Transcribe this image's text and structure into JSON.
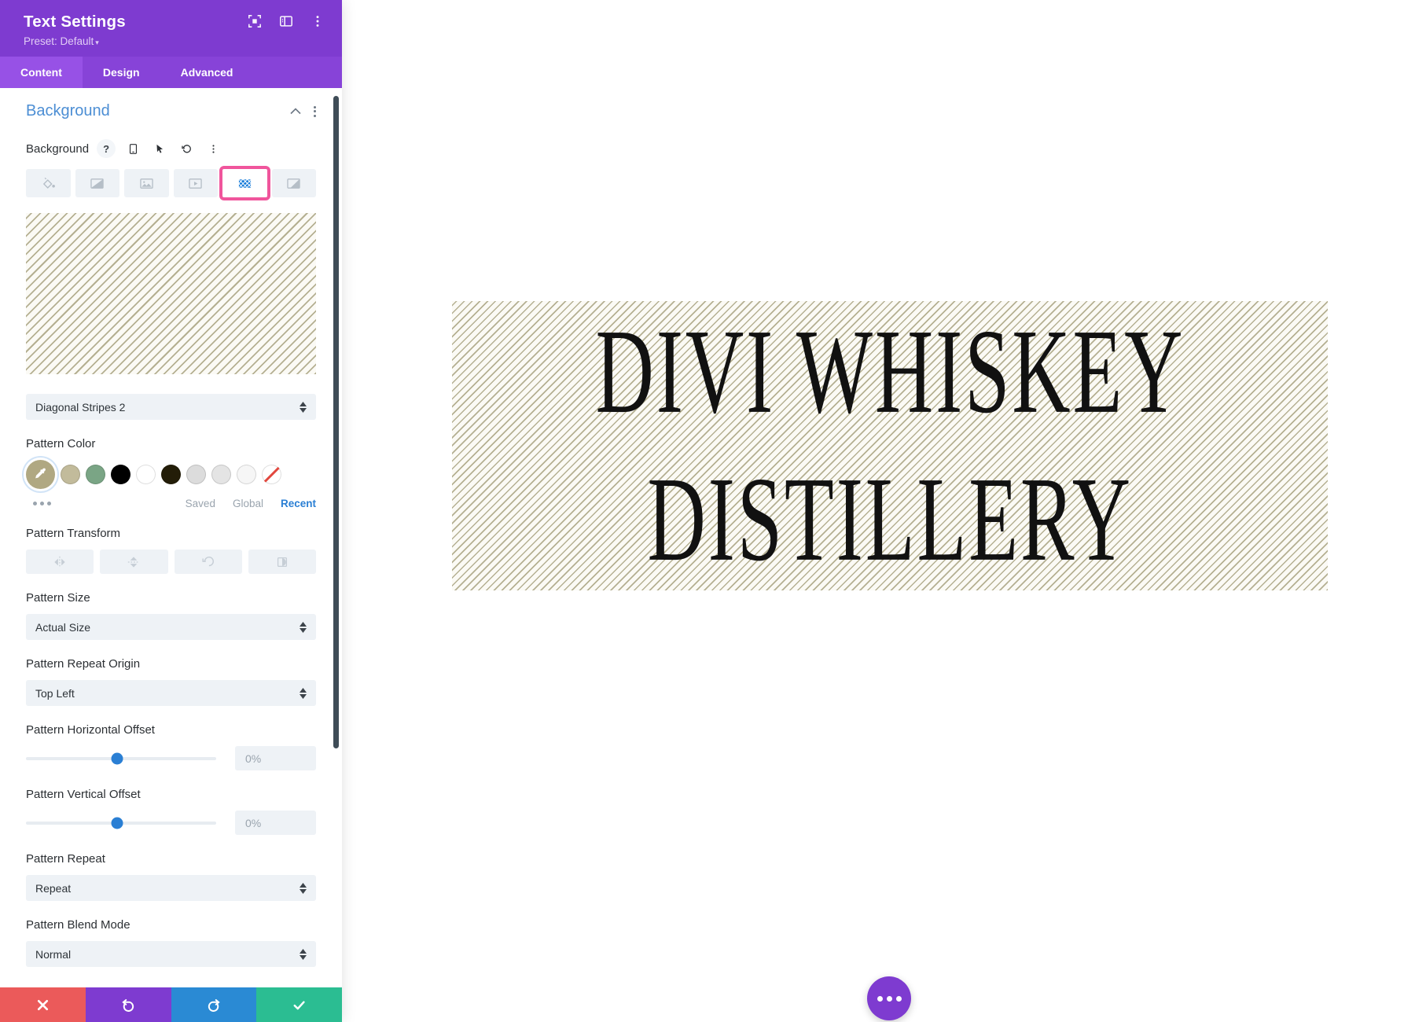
{
  "panel": {
    "title": "Text Settings",
    "preset": "Preset: Default",
    "preset_caret": "▾",
    "header_icons": [
      {
        "name": "focus-frame-icon"
      },
      {
        "name": "layout-panel-icon"
      },
      {
        "name": "kebab-menu-icon"
      }
    ],
    "tabs": [
      {
        "label": "Content",
        "active": true
      },
      {
        "label": "Design",
        "active": false
      },
      {
        "label": "Advanced",
        "active": false
      }
    ],
    "section": {
      "title": "Background",
      "collapse_icon": "chevron-up-icon",
      "more_icon": "kebab-menu-icon"
    },
    "background_field": {
      "label": "Background",
      "tools": [
        "help-icon",
        "responsive-phone-icon",
        "hover-cursor-icon",
        "reset-undo-icon",
        "kebab-menu-icon"
      ]
    },
    "background_types": [
      {
        "name": "color-fill",
        "selected": false
      },
      {
        "name": "gradient",
        "selected": false
      },
      {
        "name": "image",
        "selected": false
      },
      {
        "name": "video",
        "selected": false
      },
      {
        "name": "pattern",
        "selected": true
      },
      {
        "name": "mask",
        "selected": false
      }
    ],
    "pattern": {
      "style_value": "Diagonal Stripes 2",
      "preview_color": "#b5b092",
      "preview_bg": "#fbfaf5",
      "color_label": "Pattern Color",
      "swatches": [
        {
          "name": "eyedropper-active",
          "color": "#b0a882",
          "type": "eyedropper"
        },
        {
          "name": "swatch-khaki",
          "color": "#c2bb9b",
          "type": "solid"
        },
        {
          "name": "swatch-sage-green",
          "color": "#7aa585",
          "type": "solid"
        },
        {
          "name": "swatch-black",
          "color": "#000000",
          "type": "solid"
        },
        {
          "name": "swatch-white",
          "color": "#ffffff",
          "type": "solid"
        },
        {
          "name": "swatch-dark-olive",
          "color": "#231d08",
          "type": "solid"
        },
        {
          "name": "swatch-light-gray-1",
          "color": "#dcdcdc",
          "type": "solid"
        },
        {
          "name": "swatch-light-gray-2",
          "color": "#e4e4e4",
          "type": "solid"
        },
        {
          "name": "swatch-off-white",
          "color": "#f6f6f6",
          "type": "solid"
        },
        {
          "name": "swatch-no-color",
          "color": "#ffffff",
          "type": "none"
        }
      ],
      "meta_links": [
        {
          "label": "Saved",
          "active": false
        },
        {
          "label": "Global",
          "active": false
        },
        {
          "label": "Recent",
          "active": true
        }
      ],
      "transform_label": "Pattern Transform",
      "transform_buttons": [
        "flip-horizontal-icon",
        "flip-vertical-icon",
        "rotate-icon",
        "invert-icon"
      ],
      "size_label": "Pattern Size",
      "size_value": "Actual Size",
      "repeat_origin_label": "Pattern Repeat Origin",
      "repeat_origin_value": "Top Left",
      "horizontal_offset_label": "Pattern Horizontal Offset",
      "horizontal_offset_value": "0%",
      "vertical_offset_label": "Pattern Vertical Offset",
      "vertical_offset_value": "0%",
      "repeat_label": "Pattern Repeat",
      "repeat_value": "Repeat",
      "blend_mode_label": "Pattern Blend Mode",
      "blend_mode_value": "Normal"
    },
    "footer": [
      {
        "name": "cancel-button",
        "icon": "close-icon",
        "color": "#eb5a5a"
      },
      {
        "name": "undo-button",
        "icon": "undo-icon",
        "color": "#7e3bd0"
      },
      {
        "name": "redo-button",
        "icon": "redo-icon",
        "color": "#2a8ad4"
      },
      {
        "name": "save-button",
        "icon": "check-icon",
        "color": "#2bbd92"
      }
    ],
    "accent_selected": "#f0559c",
    "accent_purple": "#7e3bd0",
    "accent_blue": "#2a7fd4"
  },
  "canvas": {
    "hero": {
      "line1": "DIVI WHISKEY",
      "line2": "DISTILLERY",
      "pattern_color": "#b5b092",
      "bg_color": "#fbfaf5",
      "text_color": "#111111"
    },
    "fab": {
      "name": "page-settings-fab",
      "icon": "ellipsis-icon",
      "color": "#7e3bd0"
    }
  }
}
